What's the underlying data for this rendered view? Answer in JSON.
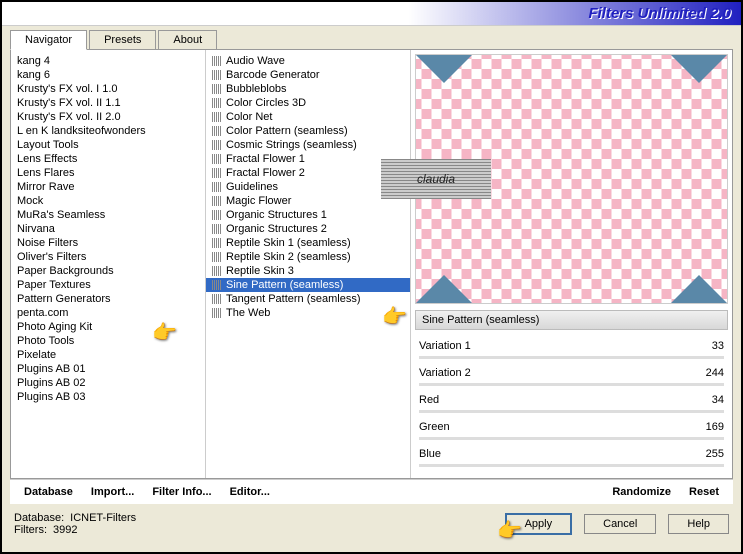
{
  "title": "Filters Unlimited 2.0",
  "tabs": [
    {
      "label": "Navigator",
      "active": true
    },
    {
      "label": "Presets",
      "active": false
    },
    {
      "label": "About",
      "active": false
    }
  ],
  "categories": [
    "kang 4",
    "kang 6",
    "Krusty's FX vol. I 1.0",
    "Krusty's FX vol. II 1.1",
    "Krusty's FX vol. II 2.0",
    "L en K landksiteofwonders",
    "Layout Tools",
    "Lens Effects",
    "Lens Flares",
    "Mirror Rave",
    "Mock",
    "MuRa's Seamless",
    "Nirvana",
    "Noise Filters",
    "Oliver's Filters",
    "Paper Backgrounds",
    "Paper Textures",
    "Pattern Generators",
    "penta.com",
    "Photo Aging Kit",
    "Photo Tools",
    "Pixelate",
    "Plugins AB 01",
    "Plugins AB 02",
    "Plugins AB 03"
  ],
  "category_selected_index": 17,
  "filters": [
    "Audio Wave",
    "Barcode Generator",
    "Bubbleblobs",
    "Color Circles 3D",
    "Color Net",
    "Color Pattern (seamless)",
    "Cosmic Strings (seamless)",
    "Fractal Flower 1",
    "Fractal Flower 2",
    "Guidelines",
    "Magic Flower",
    "Organic Structures 1",
    "Organic Structures 2",
    "Reptile Skin 1 (seamless)",
    "Reptile Skin 2 (seamless)",
    "Reptile Skin 3",
    "Sine Pattern (seamless)",
    "Tangent Pattern (seamless)",
    "The Web"
  ],
  "filter_selected_index": 16,
  "selected_filter_name": "Sine Pattern (seamless)",
  "watermark": "claudia",
  "params": [
    {
      "name": "Variation 1",
      "value": "33"
    },
    {
      "name": "Variation 2",
      "value": "244"
    },
    {
      "name": "Red",
      "value": "34"
    },
    {
      "name": "Green",
      "value": "169"
    },
    {
      "name": "Blue",
      "value": "255"
    }
  ],
  "bottom_bar": {
    "database": "Database",
    "import": "Import...",
    "filter_info": "Filter Info...",
    "editor": "Editor...",
    "randomize": "Randomize",
    "reset": "Reset"
  },
  "footer": {
    "db_label": "Database:",
    "db_value": "ICNET-Filters",
    "filters_label": "Filters:",
    "filters_value": "3992",
    "apply": "Apply",
    "cancel": "Cancel",
    "help": "Help"
  }
}
